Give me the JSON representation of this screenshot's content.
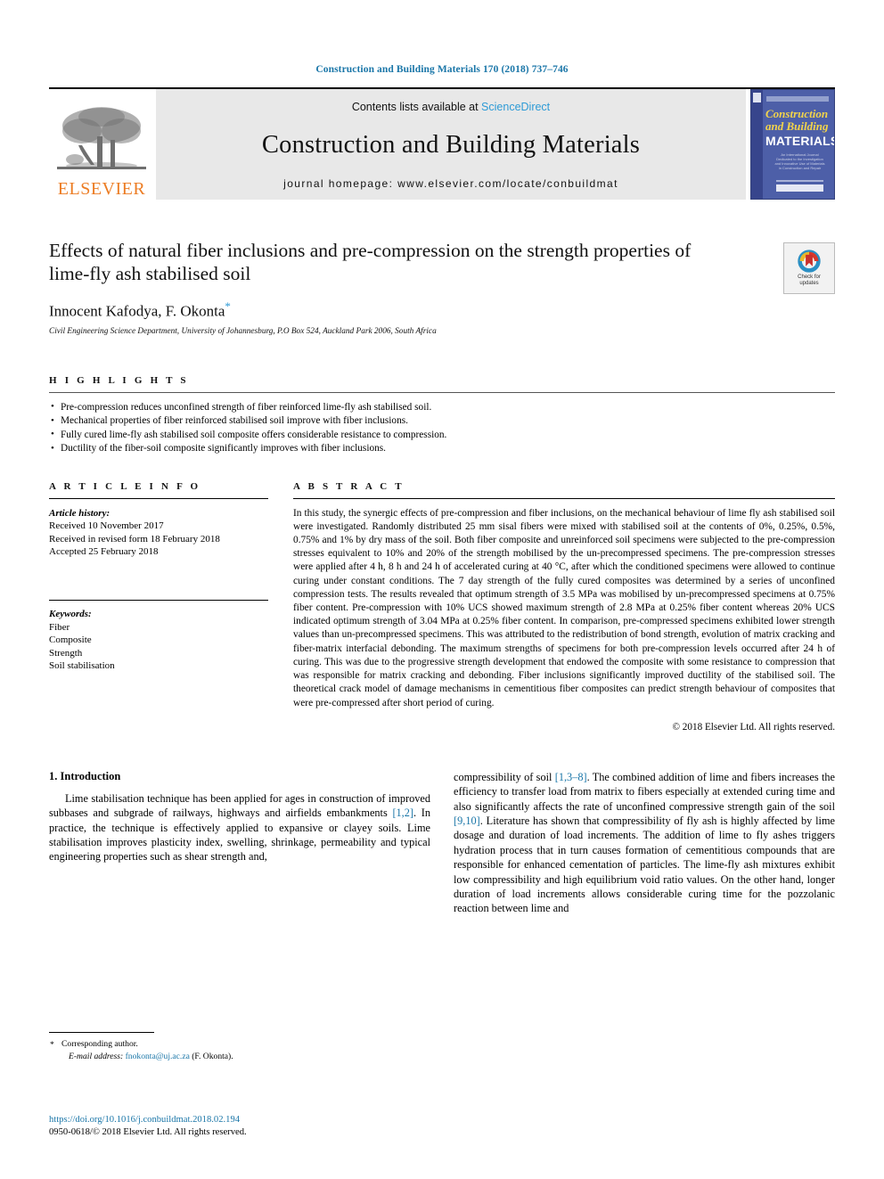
{
  "running_head": "Construction and Building Materials 170 (2018) 737–746",
  "masthead": {
    "publisher_logo_text": "ELSEVIER",
    "contents_prefix": "Contents lists available at ",
    "contents_link": "ScienceDirect",
    "journal_name": "Construction and Building Materials",
    "homepage_line": "journal homepage: www.elsevier.com/locate/conbuildmat",
    "cover": {
      "line1": "Construction",
      "line2": "and Building",
      "line3": "MATERIALS",
      "subtext": "An International Journal Dedicated to the Investigation and Innovative Use of Materials in Construction and Repair"
    }
  },
  "article": {
    "title": "Effects of natural fiber inclusions and pre-compression on the strength properties of lime-fly ash stabilised soil",
    "authors": "Innocent Kafodya, F. Okonta",
    "corresponding_marker": "*",
    "affiliation": "Civil Engineering Science Department, University of Johannesburg, P.O Box 524, Auckland Park 2006, South Africa",
    "crossmark_line1": "Check for",
    "crossmark_line2": "updates"
  },
  "highlights": {
    "heading": "H I G H L I G H T S",
    "items": [
      "Pre-compression reduces unconfined strength of fiber reinforced lime-fly ash stabilised soil.",
      "Mechanical properties of fiber reinforced stabilised soil improve with fiber inclusions.",
      "Fully cured lime-fly ash stabilised soil composite offers considerable resistance to compression.",
      "Ductility of the fiber-soil composite significantly improves with fiber inclusions."
    ]
  },
  "article_info": {
    "heading": "A R T I C L E   I N F O",
    "history_label": "Article history:",
    "history": [
      "Received 10 November 2017",
      "Received in revised form 18 February 2018",
      "Accepted 25 February 2018"
    ],
    "keywords_label": "Keywords:",
    "keywords": [
      "Fiber",
      "Composite",
      "Strength",
      "Soil stabilisation"
    ]
  },
  "abstract": {
    "heading": "A B S T R A C T",
    "text": "In this study, the synergic effects of pre-compression and fiber inclusions, on the mechanical behaviour of lime fly ash stabilised soil were investigated. Randomly distributed 25 mm sisal fibers were mixed with stabilised soil at the contents of 0%, 0.25%, 0.5%, 0.75% and 1% by dry mass of the soil. Both fiber composite and unreinforced soil specimens were subjected to the pre-compression stresses equivalent to 10% and 20% of the strength mobilised by the un-precompressed specimens. The pre-compression stresses were applied after 4 h, 8 h and 24 h of accelerated curing at 40 °C, after which the conditioned specimens were allowed to continue curing under constant conditions. The 7 day strength of the fully cured composites was determined by a series of unconfined compression tests. The results revealed that optimum strength of 3.5 MPa was mobilised by un-precompressed specimens at 0.75% fiber content. Pre-compression with 10% UCS showed maximum strength of 2.8 MPa at 0.25% fiber content whereas 20% UCS indicated optimum strength of 3.04 MPa at 0.25% fiber content. In comparison, pre-compressed specimens exhibited lower strength values than un-precompressed specimens. This was attributed to the redistribution of bond strength, evolution of matrix cracking and fiber-matrix interfacial debonding. The maximum strengths of specimens for both pre-compression levels occurred after 24 h of curing. This was due to the progressive strength development that endowed the composite with some resistance to compression that was responsible for matrix cracking and debonding. Fiber inclusions significantly improved ductility of the stabilised soil. The theoretical crack model of damage mechanisms in cementitious fiber composites can predict strength behaviour of composites that were pre-compressed after short period of curing.",
    "copyright": "© 2018 Elsevier Ltd. All rights reserved."
  },
  "introduction": {
    "heading": "1. Introduction",
    "left_paragraph_before_ref": "Lime stabilisation technique has been applied for ages in construction of improved subbases and subgrade of railways, highways and airfields embankments ",
    "left_ref": "[1,2]",
    "left_paragraph_after_ref": ". In practice, the technique is effectively applied to expansive or clayey soils. Lime stabilisation improves plasticity index, swelling, shrinkage, permeability and typical engineering properties such as shear strength and,",
    "right_part1": "compressibility of soil ",
    "right_ref1": "[1,3–8]",
    "right_part2": ". The combined addition of lime and fibers increases the efficiency to transfer load from matrix to fibers especially at extended curing time and also significantly affects the rate of unconfined compressive strength gain of the soil ",
    "right_ref2": "[9,10]",
    "right_part3": ". Literature has shown that compressibility of fly ash is highly affected by lime dosage and duration of load increments. The addition of lime to fly ashes triggers hydration process that in turn causes formation of cementitious compounds that are responsible for enhanced cementation of particles. The lime-fly ash mixtures exhibit low compressibility and high equilibrium void ratio values. On the other hand, longer duration of load increments allows considerable curing time for the pozzolanic reaction between lime and"
  },
  "footnotes": {
    "star": "*",
    "corresponding_author": "Corresponding author.",
    "email_label": "E-mail address:",
    "email": "fnokonta@uj.ac.za",
    "email_suffix": " (F. Okonta)."
  },
  "footer": {
    "doi": "https://doi.org/10.1016/j.conbuildmat.2018.02.194",
    "issn_line": "0950-0618/© 2018 Elsevier Ltd. All rights reserved."
  },
  "colors": {
    "link_blue": "#1a76a8",
    "sciencedirect_blue": "#2e9bd6",
    "elsevier_orange": "#ec7c23",
    "cover_blue": "#4d5fa8",
    "cover_yellow": "#f3d44a"
  }
}
